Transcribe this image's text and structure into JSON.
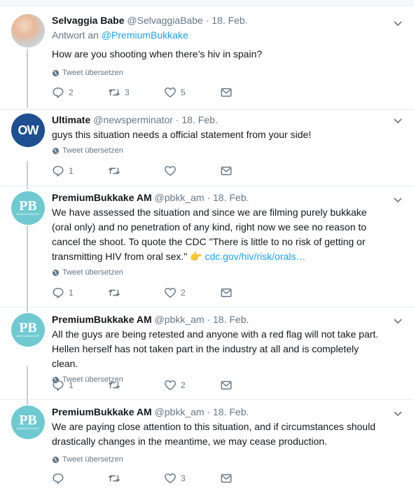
{
  "labels": {
    "translate": "Tweet übersetzen"
  },
  "tweets": [
    {
      "avatar": {
        "kind": "photo",
        "text": ""
      },
      "name": "Selvaggia Babe",
      "handle": "@SelvaggiaBabe",
      "date": "· 18. Feb.",
      "reply_prefix": "Antwort an",
      "reply_to": "@PremiumBukkake",
      "text": "How are you shooting when there’s hiv in spain?",
      "link": "",
      "counts": {
        "reply": "2",
        "retweet": "3",
        "like": "5"
      }
    },
    {
      "avatar": {
        "kind": "ow",
        "text": "OW"
      },
      "name": "Ultimate",
      "handle": "@newsperminator",
      "date": "· 18. Feb.",
      "reply_prefix": "",
      "reply_to": "",
      "text": "guys this situation needs a official statement from your side!",
      "link": "",
      "counts": {
        "reply": "1",
        "retweet": "",
        "like": ""
      }
    },
    {
      "avatar": {
        "kind": "pb",
        "text": "PB",
        "sub": "AMBASSADOR"
      },
      "name": "PremiumBukkake AM",
      "handle": "@pbkk_am",
      "date": "· 18. Feb.",
      "reply_prefix": "",
      "reply_to": "",
      "text": "We have assessed the situation and since we are filming purely bukkake (oral only) and no penetration of any kind, right now we see no reason to cancel the shoot. To quote the CDC \"There is little to no risk of getting or transmitting HIV from oral sex.\" 👉",
      "link": "cdc.gov/hiv/risk/orals…",
      "counts": {
        "reply": "1",
        "retweet": "",
        "like": "2"
      }
    },
    {
      "avatar": {
        "kind": "pb",
        "text": "PB",
        "sub": "AMBASSADOR"
      },
      "name": "PremiumBukkake AM",
      "handle": "@pbkk_am",
      "date": "· 18. Feb.",
      "reply_prefix": "",
      "reply_to": "",
      "text": "All the guys are being retested and anyone with a red flag will not take part. Hellen herself has not taken part in the industry at all and is completely clean.",
      "link": "",
      "counts": {
        "reply": "1",
        "retweet": "",
        "like": "2"
      }
    },
    {
      "avatar": {
        "kind": "pb",
        "text": "PB",
        "sub": "AMBASSADOR"
      },
      "name": "PremiumBukkake AM",
      "handle": "@pbkk_am",
      "date": "· 18. Feb.",
      "reply_prefix": "",
      "reply_to": "",
      "text": "We are paying close attention to this situation, and if circumstances should drastically changes in the meantime, we may cease production.",
      "link": "",
      "counts": {
        "reply": "",
        "retweet": "",
        "like": "3"
      }
    }
  ]
}
